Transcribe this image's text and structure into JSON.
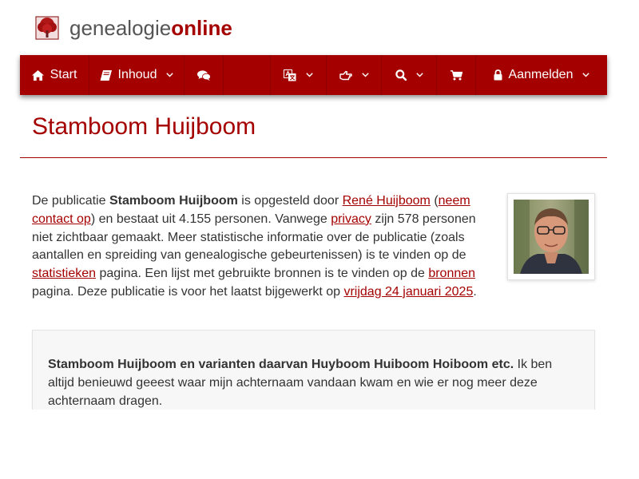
{
  "brand": {
    "name_part1": "genealogie",
    "name_part2": "online",
    "accent_color": "#a50000",
    "logo_icon": "tree-logo-icon"
  },
  "nav": {
    "start_label": "Start",
    "inhoud_label": "Inhoud",
    "login_label": "Aanmelden",
    "icons": [
      "home-icon",
      "book-icon",
      "comments-icon",
      "translate-icon",
      "hand-pointer-icon",
      "search-icon",
      "shopping-cart-icon",
      "lock-icon",
      "chevron-down-icon"
    ]
  },
  "page": {
    "title": "Stamboom Huijboom"
  },
  "intro": {
    "t1": "De publicatie ",
    "pub_name": "Stamboom Huijboom",
    "t2": " is opgesteld door ",
    "author_link": "René Huijboom",
    "t3": " (",
    "contact_link": "neem contact op",
    "t4": ") en bestaat uit 4.155 personen. Vanwege ",
    "privacy_link": "privacy",
    "t5": " zijn 578 personen niet zichtbaar gemaakt. Meer statistische informatie over de publicatie (zoals aantallen en spreiding van genealogische gebeurtenissen) is te vinden op de ",
    "stats_link": "statistieken",
    "t6": " pagina. Een lijst met gebruikte bronnen is te vinden op de ",
    "sources_link": "bronnen",
    "t7": " pagina. Deze publicatie is voor het laatst bijgewerkt op ",
    "date_link": "vrijdag 24 januari 2025",
    "t8": "."
  },
  "description": {
    "bold": "Stamboom Huijboom en varianten daarvan Huyboom Huiboom Hoiboom etc.",
    "text": " Ik ben altijd benieuwd geeest waar mijn achternaam vandaan kwam en wie er nog meer deze achternaam dragen."
  }
}
